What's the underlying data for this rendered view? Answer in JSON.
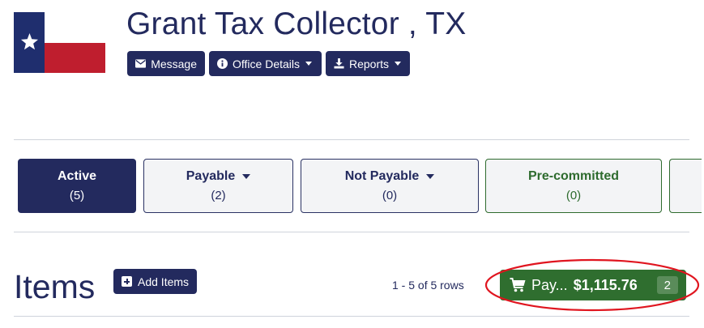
{
  "header": {
    "title": "Grant Tax Collector , TX",
    "flag_colors": {
      "blue": "#1f2e6e",
      "white": "#ffffff",
      "red": "#bf1e2e"
    }
  },
  "toolbar": {
    "message_label": "Message",
    "office_details_label": "Office Details",
    "reports_label": "Reports"
  },
  "tabs": [
    {
      "label": "Active",
      "count": "(5)",
      "state": "active"
    },
    {
      "label": "Payable",
      "count": "(2)",
      "has_dropdown": true
    },
    {
      "label": "Not Payable",
      "count": "(0)",
      "has_dropdown": true
    },
    {
      "label": "Pre-committed",
      "count": "(0)",
      "accent": "#2e6b2e"
    }
  ],
  "items_section": {
    "title": "Items",
    "add_items_label": "Add Items",
    "rows_text": "1 - 5 of 5 rows",
    "pay_button": {
      "label": "Pay...",
      "amount": "$1,115.76",
      "badge": "2",
      "color": "#2f6e2f"
    },
    "highlight_color": "#e0151f"
  }
}
